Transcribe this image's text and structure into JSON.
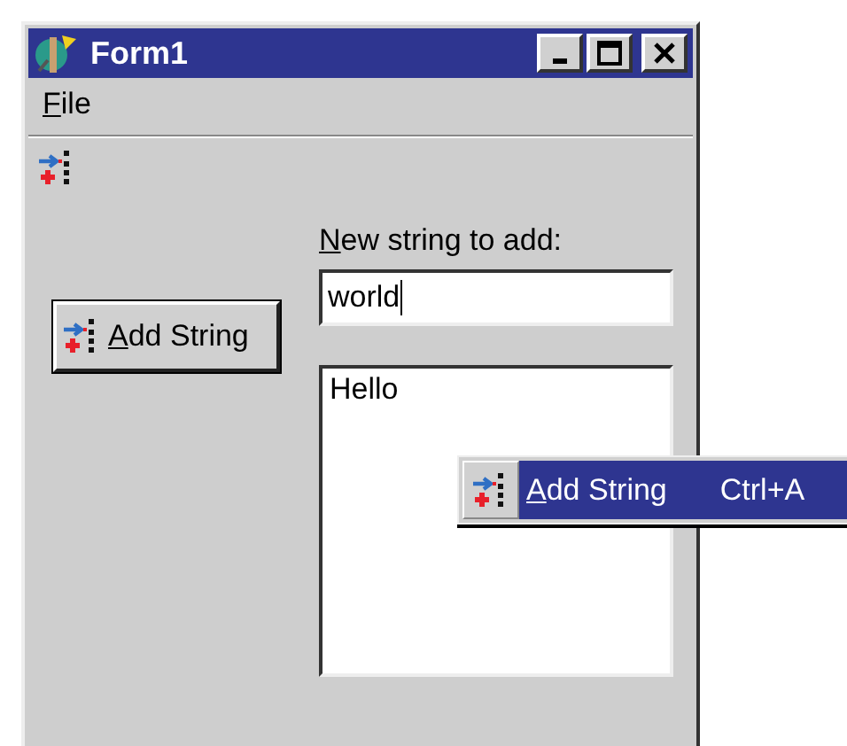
{
  "window": {
    "title": "Form1"
  },
  "menu_bar": [
    {
      "label": "File"
    }
  ],
  "form": {
    "add_button": {
      "label": "Add String"
    },
    "input_label": "New string to add:",
    "input": {
      "value": "world"
    },
    "list": [
      {
        "text": "Hello"
      }
    ]
  },
  "context_menu": [
    {
      "label": "Add String",
      "shortcut": "Ctrl+A",
      "selected": true
    }
  ]
}
